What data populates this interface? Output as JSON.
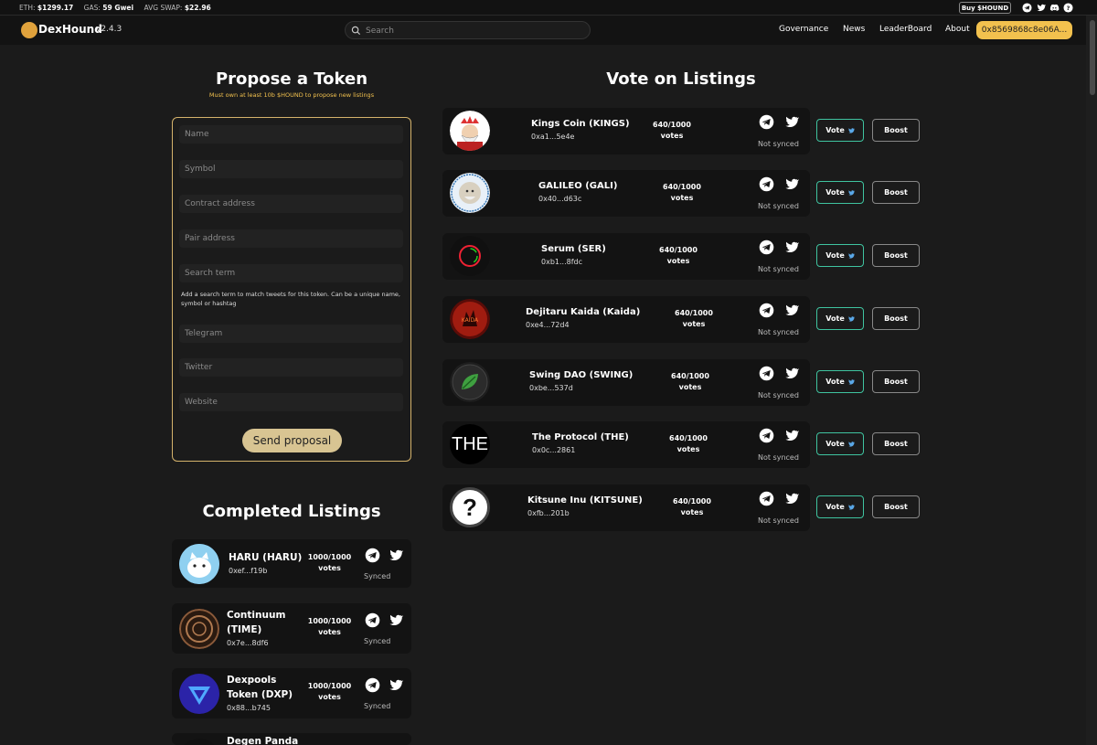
{
  "ticker": {
    "eth_label": "ETH:",
    "eth_value": "$1299.17",
    "gas_label": "GAS:",
    "gas_value": "59 Gwei",
    "swap_label": "AVG SWAP:",
    "swap_value": "$22.96",
    "buy_label": "Buy $HOUND",
    "socials": [
      "telegram-icon",
      "twitter-icon",
      "discord-icon",
      "help-icon"
    ]
  },
  "nav": {
    "brand": "DexHound",
    "version": "v2.4.3",
    "search_placeholder": "Search",
    "links": [
      "Governance",
      "News",
      "LeaderBoard",
      "About"
    ],
    "wallet": "0x8569868c8e06A..."
  },
  "propose": {
    "title": "Propose a Token",
    "note": "Must own at least 10b $HOUND to propose new listings",
    "fields": {
      "name": "Name",
      "symbol": "Symbol",
      "contract": "Contract address",
      "pair": "Pair address",
      "search_term": "Search term",
      "telegram": "Telegram",
      "twitter": "Twitter",
      "website": "Website"
    },
    "help": "Add a search term to match tweets for this token. Can be a unique name, symbol or hashtag",
    "submit": "Send proposal"
  },
  "vote": {
    "title": "Vote on Listings",
    "vote_label": "Vote",
    "boost_label": "Boost",
    "votes_unit": "votes",
    "listings": [
      {
        "name": "Kings Coin (KINGS)",
        "addr": "0xa1...5e4e",
        "votes": "640/1000",
        "status": "Not synced"
      },
      {
        "name": "GALILEO (GALI)",
        "addr": "0x40...d63c",
        "votes": "640/1000",
        "status": "Not synced"
      },
      {
        "name": "Serum (SER)",
        "addr": "0xb1...8fdc",
        "votes": "640/1000",
        "status": "Not synced"
      },
      {
        "name": "Dejitaru Kaida (Kaida)",
        "addr": "0xe4...72d4",
        "votes": "640/1000",
        "status": "Not synced"
      },
      {
        "name": "Swing DAO (SWING)",
        "addr": "0xbe...537d",
        "votes": "640/1000",
        "status": "Not synced"
      },
      {
        "name": "The Protocol (THE)",
        "addr": "0x0c...2861",
        "votes": "640/1000",
        "status": "Not synced",
        "logo_text": "THE"
      },
      {
        "name": "Kitsune Inu (KITSUNE)",
        "addr": "0xfb...201b",
        "votes": "640/1000",
        "status": "Not synced",
        "logo_text": "?"
      }
    ]
  },
  "completed": {
    "title": "Completed Listings",
    "votes_unit": "votes",
    "items": [
      {
        "name": "HARU (HARU)",
        "addr": "0xef...f19b",
        "votes": "1000/1000",
        "status": "Synced"
      },
      {
        "name_line1": "Continuum",
        "name_line2": "(TIME)",
        "addr": "0x7e...8df6",
        "votes": "1000/1000",
        "status": "Synced"
      },
      {
        "name_line1": "Dexpools",
        "name_line2": "Token (DXP)",
        "addr": "0x88...b745",
        "votes": "1000/1000",
        "status": "Synced"
      },
      {
        "name_line1": "Degen Panda"
      }
    ]
  },
  "colors": {
    "accent": "#f2c14e",
    "vote_border": "#3fc4a0",
    "form_border": "#d4b26b",
    "background": "#1b1b1b"
  }
}
